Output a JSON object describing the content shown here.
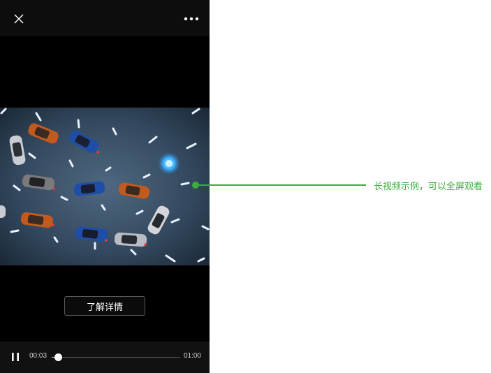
{
  "player": {
    "close_icon": "close-icon",
    "more_icon": "more-icon",
    "detail_button_label": "了解详情",
    "controls": {
      "pause_icon": "pause-icon",
      "current_time": "00:03",
      "total_time": "01:00",
      "progress": 0.05
    }
  },
  "annotation": {
    "text": "长视频示例，可以全屏观看",
    "color": "#3cad3c"
  }
}
